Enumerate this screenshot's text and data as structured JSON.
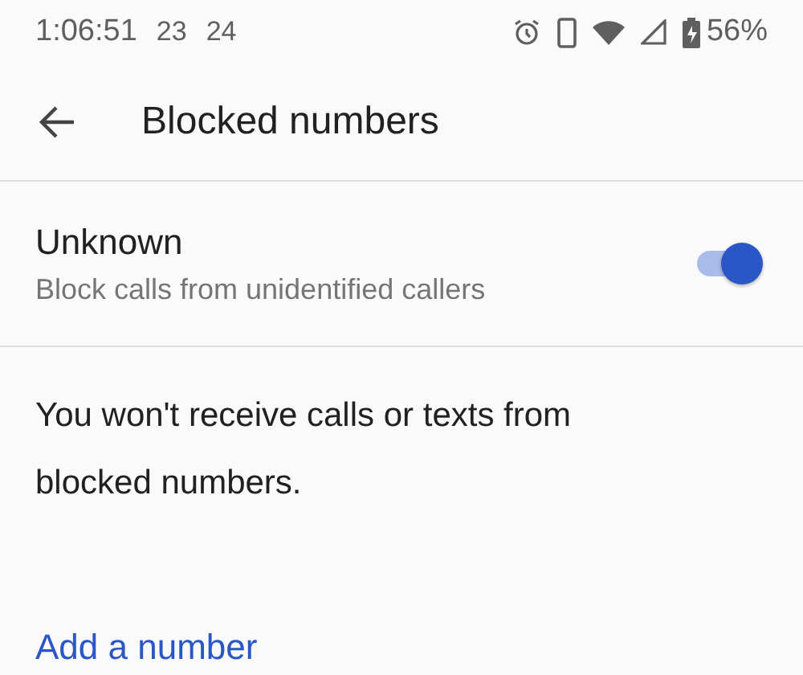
{
  "status_bar": {
    "time": "1:06:51",
    "notifications": [
      "23",
      "24"
    ],
    "battery": "56%"
  },
  "toolbar": {
    "title": "Blocked numbers"
  },
  "setting": {
    "title": "Unknown",
    "summary": "Block calls from unidentified callers",
    "on": true
  },
  "info": "You won't receive calls or texts from blocked numbers.",
  "add_link": "Add a number"
}
